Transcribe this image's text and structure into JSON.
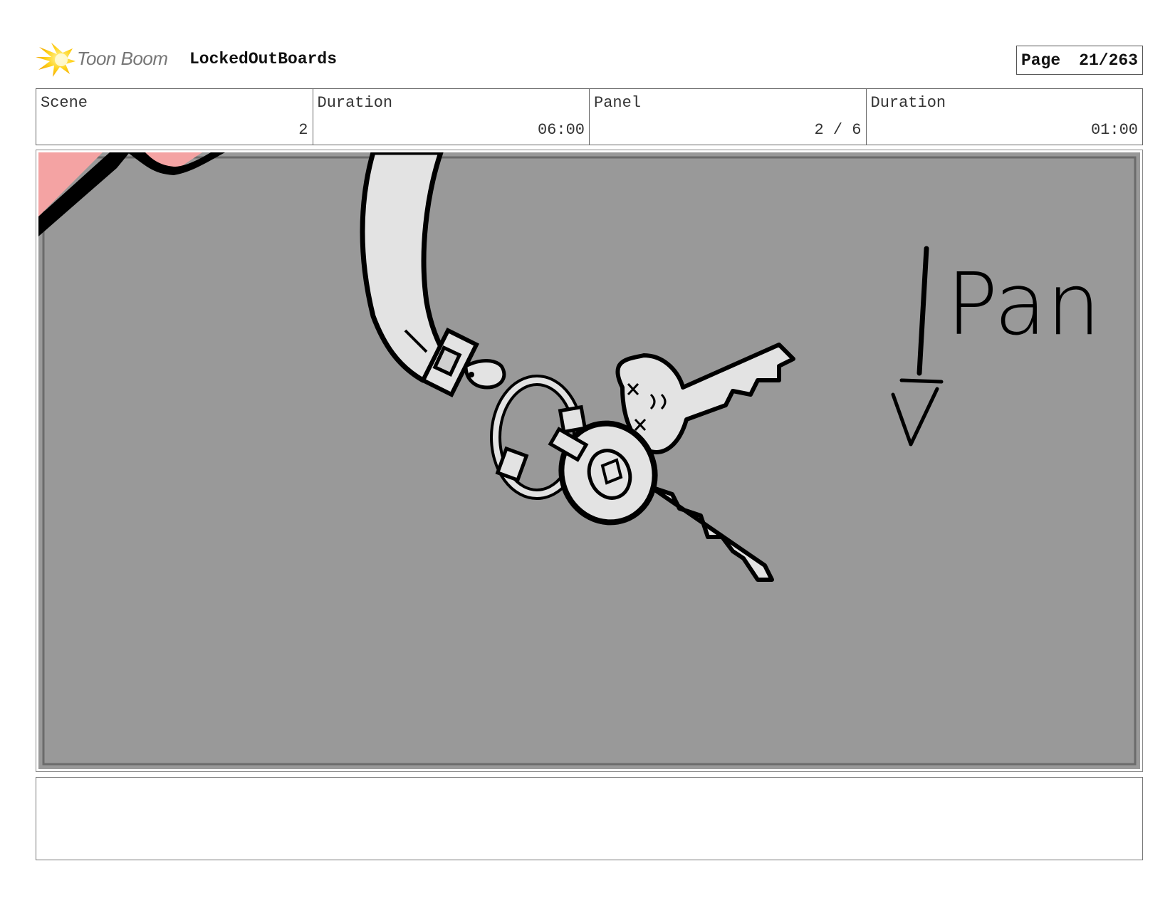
{
  "header": {
    "logo_text": "Toon Boom",
    "project_title": "LockedOutBoards",
    "page_label": "Page",
    "page_value": "21/263"
  },
  "info": {
    "scene_label": "Scene",
    "scene_value": "2",
    "scene_duration_label": "Duration",
    "scene_duration_value": "06:00",
    "panel_label": "Panel",
    "panel_value": "2 / 6",
    "panel_duration_label": "Duration",
    "panel_duration_value": "01:00"
  },
  "panel": {
    "annotation": "Pan",
    "background_color": "#999999",
    "accent_color": "#f4a3a3"
  },
  "notes": {
    "text": ""
  }
}
